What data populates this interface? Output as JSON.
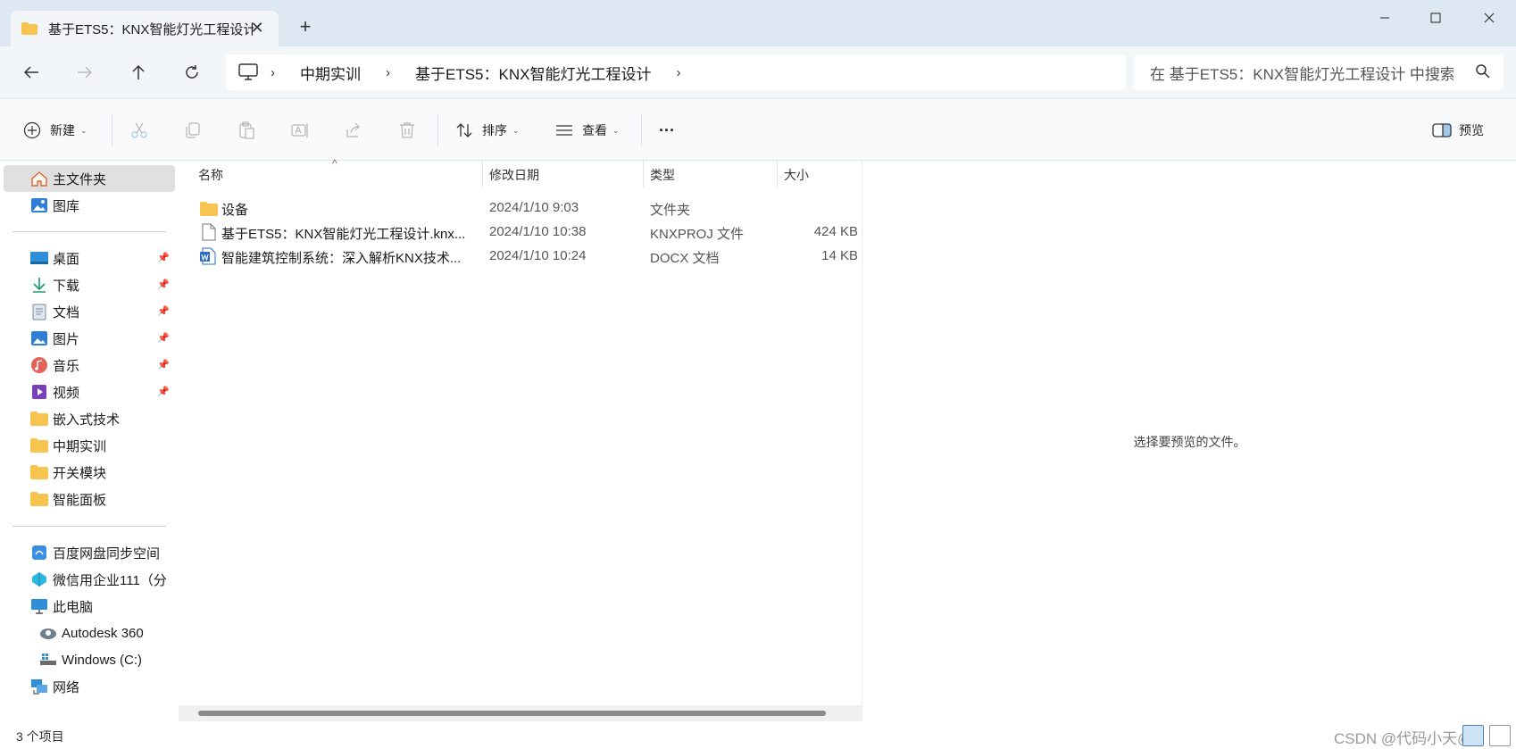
{
  "window": {
    "tab_title": "基于ETS5：KNX智能灯光工程设计",
    "tab_close": "✕",
    "new_tab": "+"
  },
  "nav": {
    "breadcrumbs": [
      "中期实训",
      "基于ETS5：KNX智能灯光工程设计"
    ],
    "search_placeholder": "在 基于ETS5：KNX智能灯光工程设计 中搜索"
  },
  "toolbar": {
    "new_label": "新建",
    "sort_label": "排序",
    "view_label": "查看",
    "more_label": "···",
    "preview_label": "预览"
  },
  "sidebar": {
    "top_items": [
      {
        "label": "主文件夹",
        "icon": "home-icon"
      },
      {
        "label": "图库",
        "icon": "gallery-icon"
      }
    ],
    "quick_items": [
      {
        "label": "桌面",
        "icon": "desktop-icon"
      },
      {
        "label": "下载",
        "icon": "download-icon"
      },
      {
        "label": "文档",
        "icon": "documents-icon"
      },
      {
        "label": "图片",
        "icon": "pictures-icon"
      },
      {
        "label": "音乐",
        "icon": "music-icon"
      },
      {
        "label": "视频",
        "icon": "videos-icon"
      },
      {
        "label": "嵌入式技术",
        "icon": "folder-icon"
      },
      {
        "label": "中期实训",
        "icon": "folder-icon"
      },
      {
        "label": "开关模块",
        "icon": "folder-icon"
      },
      {
        "label": "智能面板",
        "icon": "folder-icon"
      }
    ],
    "bottom_items": [
      {
        "label": "百度网盘同步空间",
        "icon": "baidu-netdisk-icon"
      },
      {
        "label": "微信用企业111（分",
        "icon": "cloud-icon"
      },
      {
        "label": "此电脑",
        "icon": "this-pc-icon"
      },
      {
        "label": "Autodesk 360",
        "icon": "autodesk-icon"
      },
      {
        "label": "Windows (C:)",
        "icon": "drive-icon"
      },
      {
        "label": "网络",
        "icon": "network-icon"
      }
    ]
  },
  "files": {
    "columns": [
      "名称",
      "修改日期",
      "类型",
      "大小"
    ],
    "rows": [
      {
        "name": "设备",
        "date": "2024/1/10 9:03",
        "type": "文件夹",
        "size": "",
        "icon": "folder-icon"
      },
      {
        "name": "基于ETS5：KNX智能灯光工程设计.knx...",
        "date": "2024/1/10 10:38",
        "type": "KNXPROJ 文件",
        "size": "424 KB",
        "icon": "file-icon"
      },
      {
        "name": "智能建筑控制系统：深入解析KNX技术...",
        "date": "2024/1/10 10:24",
        "type": "DOCX 文档",
        "size": "14 KB",
        "icon": "word-icon"
      }
    ]
  },
  "preview": {
    "message": "选择要预览的文件。"
  },
  "status": {
    "count": "3 个项目",
    "watermark": "CSDN @代码小天@"
  },
  "colors": {
    "accent": "#0067c0",
    "folder": "#f6c44f",
    "titlebar": "#dde8f3"
  }
}
